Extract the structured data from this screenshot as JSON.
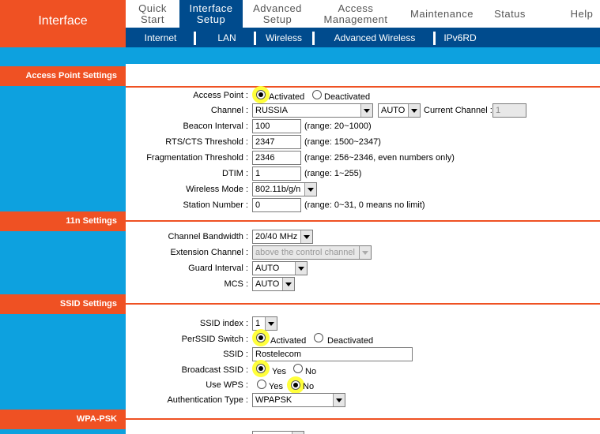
{
  "header": {
    "brand": "Interface",
    "nav": [
      {
        "label": "Quick\nStart",
        "active": false
      },
      {
        "label": "Interface\nSetup",
        "active": true
      },
      {
        "label": "Advanced\nSetup",
        "active": false
      },
      {
        "label": "Access\nManagement",
        "active": false
      },
      {
        "label": "Maintenance",
        "active": false
      },
      {
        "label": "Status",
        "active": false
      },
      {
        "label": "Help",
        "active": false
      }
    ],
    "subnav": [
      "Internet",
      "LAN",
      "Wireless",
      "Advanced Wireless",
      "IPv6RD"
    ]
  },
  "sections": {
    "access_point": "Access Point Settings",
    "n11": "11n Settings",
    "ssid": "SSID Settings",
    "wpa": "WPA-PSK"
  },
  "ap": {
    "access_point_label": "Access Point :",
    "activated": "Activated",
    "deactivated": "Deactivated",
    "channel_label": "Channel :",
    "channel_country": "RUSSIA",
    "channel_value": "AUTO",
    "current_channel_label": "Current Channel :",
    "current_channel_value": "1",
    "beacon_label": "Beacon Interval :",
    "beacon_value": "100",
    "beacon_note": "(range: 20~1000)",
    "rts_label": "RTS/CTS Threshold :",
    "rts_value": "2347",
    "rts_note": "(range: 1500~2347)",
    "frag_label": "Fragmentation Threshold :",
    "frag_value": "2346",
    "frag_note": "(range: 256~2346, even numbers only)",
    "dtim_label": "DTIM :",
    "dtim_value": "1",
    "dtim_note": "(range: 1~255)",
    "mode_label": "Wireless Mode :",
    "mode_value": "802.11b/g/n",
    "station_label": "Station Number :",
    "station_value": "0",
    "station_note": "(range: 0~31, 0 means no limit)"
  },
  "n11": {
    "bw_label": "Channel Bandwidth :",
    "bw_value": "20/40 MHz",
    "ext_label": "Extension Channel :",
    "ext_value": "above the control channel",
    "guard_label": "Guard Interval :",
    "guard_value": "AUTO",
    "mcs_label": "MCS :",
    "mcs_value": "AUTO"
  },
  "ssid": {
    "index_label": "SSID index :",
    "index_value": "1",
    "perssid_label": "PerSSID Switch :",
    "activated": "Activated",
    "deactivated": "Deactivated",
    "ssid_label": "SSID :",
    "ssid_value": "Rostelecom",
    "broadcast_label": "Broadcast SSID :",
    "yes": "Yes",
    "no": "No",
    "wps_label": "Use WPS :",
    "auth_label": "Authentication Type :",
    "auth_value": "WPAPSK"
  },
  "colors": {
    "orange": "#ef5123",
    "navy": "#004b8d",
    "sky": "#0da1df",
    "highlight": "#ffff3c"
  }
}
